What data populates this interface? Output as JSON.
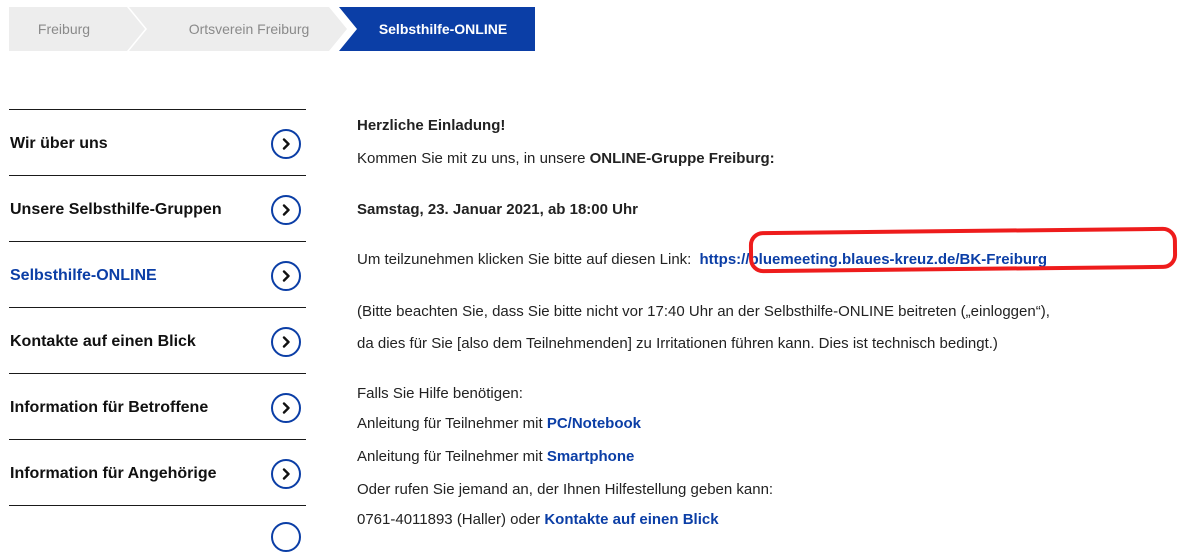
{
  "breadcrumb": {
    "items": [
      "Freiburg",
      "Ortsverein Freiburg"
    ],
    "active": "Selbsthilfe-ONLINE"
  },
  "sidebar": {
    "items": [
      {
        "label": "Wir über uns"
      },
      {
        "label": "Unsere Selbsthilfe-Gruppen"
      },
      {
        "label": "Selbsthilfe-ONLINE"
      },
      {
        "label": "Kontakte auf einen Blick"
      },
      {
        "label": "Information für Betroffene"
      },
      {
        "label": "Information für Angehörige"
      }
    ]
  },
  "content": {
    "heading": "Herzliche Einladung!",
    "invite_prefix": "Kommen Sie mit zu uns, in unsere ",
    "invite_bold": "ONLINE-Gruppe Freiburg:",
    "date": "Samstag, 23. Januar 2021, ab 18:00 Uhr",
    "link_prefix": "Um teilzunehmen klicken Sie bitte auf diesen Link: ",
    "meeting_link": "https://bluemeeting.blaues-kreuz.de/BK-Freiburg",
    "note_line1": "(Bitte beachten Sie, dass Sie bitte nicht vor 17:40 Uhr an der Selbsthilfe-ONLINE beitreten („einloggen“),",
    "note_line2": "da dies für Sie [also dem Teilnehmenden] zu Irritationen führen kann. Dies ist technisch bedingt.)",
    "help_intro": "Falls Sie Hilfe benötigen:",
    "guide_prefix": "Anleitung für Teilnehmer mit ",
    "guide_pc": "PC/Notebook",
    "guide_phone": "Smartphone",
    "call_text": "Oder rufen Sie jemand an, der Ihnen Hilfestellung geben kann:",
    "phone_prefix": "0761-4011893 (Haller) oder ",
    "contacts_link": "Kontakte auf einen Blick"
  },
  "colors": {
    "accent": "#0b3ea6",
    "highlight": "#ee1c1c",
    "crumb_bg": "#ededed"
  }
}
